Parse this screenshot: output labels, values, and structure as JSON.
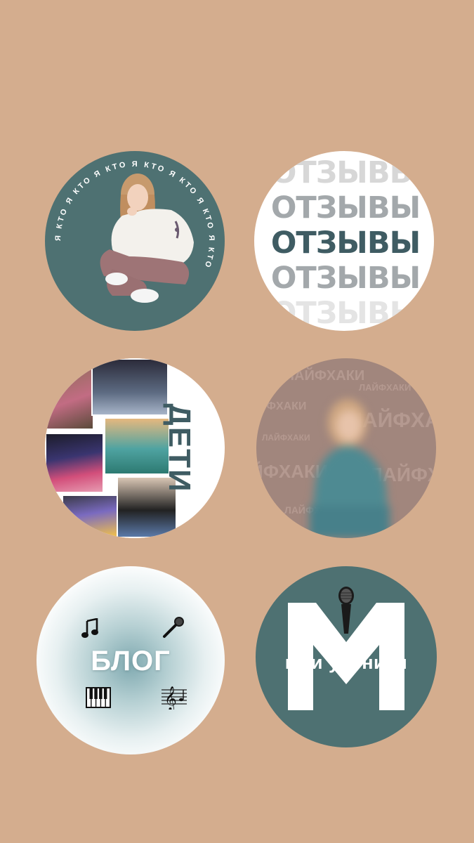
{
  "page": {
    "background": "#d4ad8e"
  },
  "highlights": {
    "who": {
      "ring_text": "Я КТО Я КТО Я КТО Я КТО Я КТО Я КТО Я КТО",
      "color": "#4e7172"
    },
    "reviews": {
      "rows": [
        "ОТЗЫВЫ",
        "ОТЗЫВЫ",
        "ОТЗЫВЫ",
        "ОТЗЫВЫ",
        "ОТЗЫВЫ"
      ],
      "accent": "#3f5c63"
    },
    "kids": {
      "title": "ДЕТИ",
      "accent": "#3f5c63"
    },
    "lifehacks": {
      "words": [
        "ЛАЙФХАКИ",
        "ЛАЙФХАКИ",
        "ЛАЙФХАКИ",
        "ЛАЙФХАКИ",
        "ЛАЙФХАКИ",
        "ЛАЙФХАКИ",
        "ЛАЙФХАКИ",
        "ЛАЙФХАКИ"
      ],
      "color": "#a1867d"
    },
    "blog": {
      "title": "БЛОГ",
      "icons": [
        "music-note-icon",
        "microphone-icon",
        "piano-keys-icon",
        "treble-clef-icon"
      ]
    },
    "students": {
      "label": "мои ученики",
      "icons": [
        "microphone-icon"
      ],
      "color": "#4e7172"
    }
  }
}
